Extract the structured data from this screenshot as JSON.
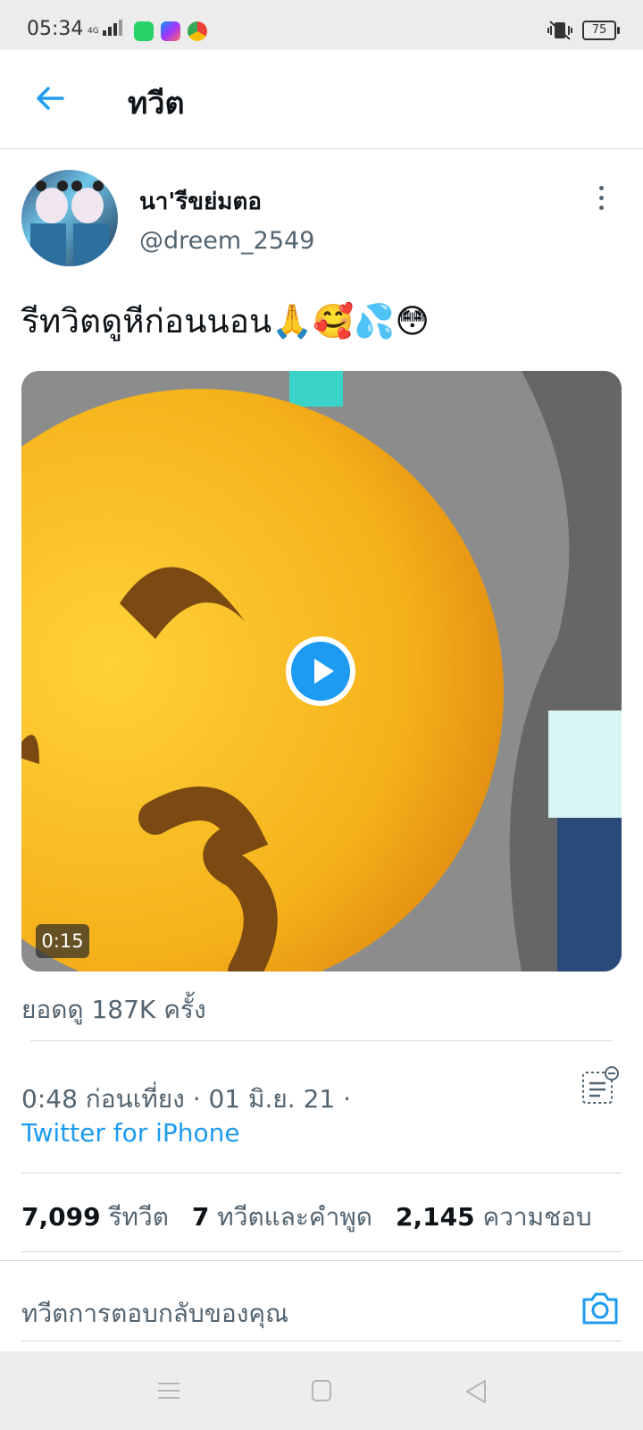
{
  "status_bar": {
    "time": "05:34",
    "network": "4G",
    "battery": "75",
    "icons": [
      "network-signal-icon",
      "whatsapp-icon",
      "messenger-icon",
      "chrome-icon",
      "vibrate-icon",
      "battery-icon"
    ]
  },
  "header": {
    "title": "ทวีต",
    "back_icon": "back-arrow-icon"
  },
  "tweet": {
    "author_name": "นา'รีขย่มตอ",
    "handle": "@dreem_2549",
    "text": "รีทวิตดูหีก่อนนอน🙏🥰💦😳",
    "video_duration": "0:15",
    "views": "ยอดดู 187K ครั้ง",
    "date": "0:48 ก่อนเที่ยง · 01 มิ.ย. 21 ·",
    "source": "Twitter for iPhone"
  },
  "stats": {
    "retweets_count": "7,099",
    "retweets_label": "รีทวีต",
    "quotes_count": "7",
    "quotes_label": "ทวีตและคำพูด",
    "likes_count": "2,145",
    "likes_label": "ความชอบ"
  },
  "reply": {
    "placeholder": "ทวีตการตอบกลับของคุณ"
  },
  "colors": {
    "accent": "#1d9bf0",
    "text_primary": "#0f1419",
    "text_secondary": "#536471"
  }
}
